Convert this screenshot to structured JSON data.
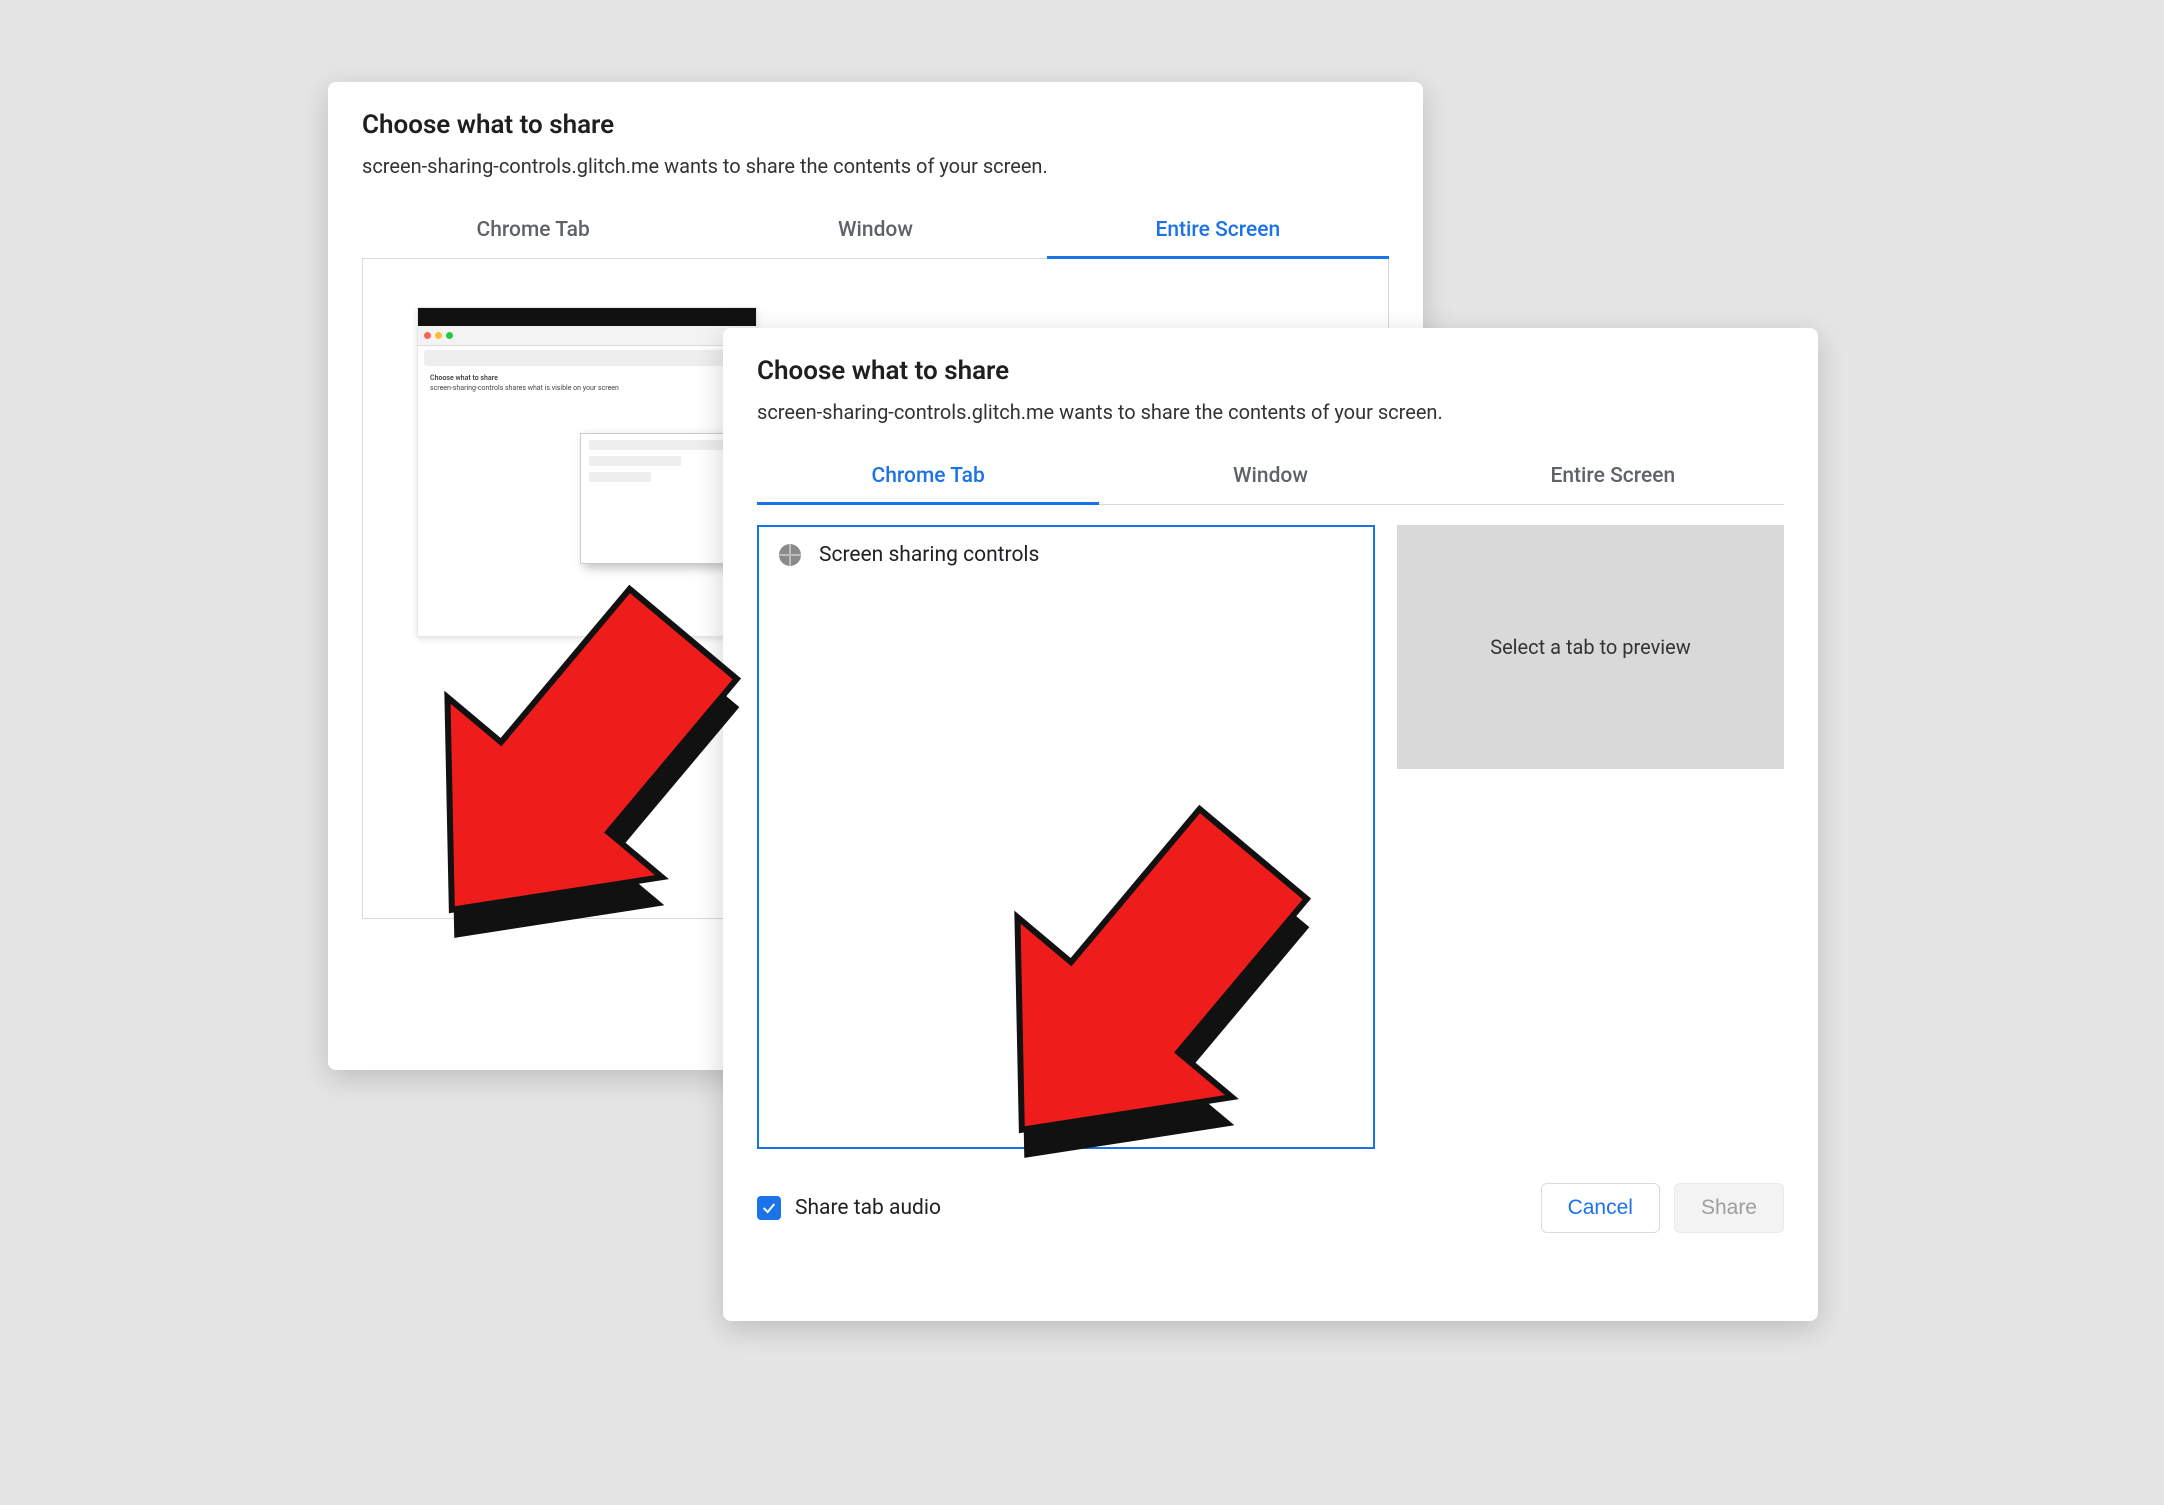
{
  "back": {
    "title": "Choose what to share",
    "subtitle": "screen-sharing-controls.glitch.me wants to share the contents of your screen.",
    "tabs": {
      "chrome": "Chrome Tab",
      "window": "Window",
      "entire": "Entire Screen"
    },
    "active_tab": "entire"
  },
  "front": {
    "title": "Choose what to share",
    "subtitle": "screen-sharing-controls.glitch.me wants to share the contents of your screen.",
    "tabs": {
      "chrome": "Chrome Tab",
      "window": "Window",
      "entire": "Entire Screen"
    },
    "active_tab": "chrome",
    "tab_items": [
      {
        "label": "Screen sharing controls"
      }
    ],
    "preview_placeholder": "Select a tab to preview",
    "share_audio_label": "Share tab audio",
    "share_audio_checked": true,
    "buttons": {
      "cancel": "Cancel",
      "share": "Share"
    }
  },
  "colors": {
    "accent": "#1a73e8"
  }
}
